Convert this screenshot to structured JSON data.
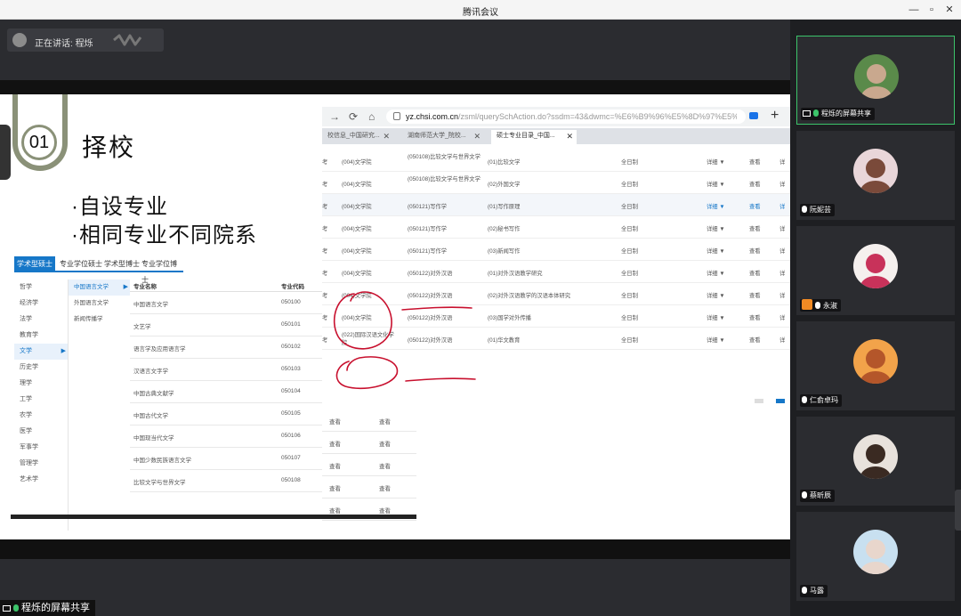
{
  "app": {
    "title": "腾讯会议"
  },
  "window_controls": [
    "—",
    "▫",
    "✕"
  ],
  "speaking": {
    "label": "正在讲话:",
    "name": "程烁"
  },
  "slide": {
    "number": "01",
    "title": "择校",
    "bullets": [
      "·自设专业",
      "·相同专业不同院系"
    ]
  },
  "degree_tabs": [
    "学术型硕士",
    "专业学位硕士",
    "学术型博士",
    "专业学位博士"
  ],
  "subjects": [
    "哲学",
    "经济学",
    "法学",
    "教育学",
    "文学",
    "历史学",
    "理学",
    "工学",
    "农学",
    "医学",
    "军事学",
    "管理学",
    "艺术学"
  ],
  "subjects_active": "文学",
  "subcategories": [
    "中国语言文学",
    "外国语言文学",
    "新闻传播学"
  ],
  "major_table": {
    "headers": [
      "专业名称",
      "专业代码"
    ],
    "rows": [
      [
        "中国语言文学",
        "050100"
      ],
      [
        "文艺学",
        "050101"
      ],
      [
        "语言学及应用语言学",
        "050102"
      ],
      [
        "汉语言文字学",
        "050103"
      ],
      [
        "中国古典文献学",
        "050104"
      ],
      [
        "中国古代文学",
        "050105"
      ],
      [
        "中国现当代文学",
        "050106"
      ],
      [
        "中国少数民族语言文学",
        "050107"
      ],
      [
        "比较文学与世界文学",
        "050108"
      ]
    ]
  },
  "extra_actions": [
    [
      "查看",
      "查看"
    ],
    [
      "查看",
      "查看"
    ],
    [
      "查看",
      "查看"
    ],
    [
      "查看",
      "查看"
    ],
    [
      "查看",
      "查看"
    ]
  ],
  "browser": {
    "url_host": "yz.chsi.com.cn",
    "url_path": "/zsml/querySchAction.do?ssdm=43&dwmc=%E6%B9%96%E5%8D%97%E5%B",
    "tabs": [
      "校信息_中国研究...",
      "湖南师范大学_院校...",
      "硕士专业目录_中国..."
    ],
    "rows": [
      [
        "考",
        "(004)文学院",
        "(050108)比较文学与世界文学",
        "(01)比较文学",
        "全日制",
        "详细 ▼",
        "查看",
        "详"
      ],
      [
        "考",
        "(004)文学院",
        "(050108)比较文学与世界文学",
        "(02)外国文学",
        "全日制",
        "详细 ▼",
        "查看",
        "详"
      ],
      [
        "考",
        "(004)文学院",
        "(050121)写作学",
        "(01)写作原理",
        "全日制",
        "详细 ▼",
        "查看",
        "详"
      ],
      [
        "考",
        "(004)文学院",
        "(050121)写作学",
        "(02)秘书写作",
        "全日制",
        "详细 ▼",
        "查看",
        "详"
      ],
      [
        "考",
        "(004)文学院",
        "(050121)写作学",
        "(03)新闻写作",
        "全日制",
        "详细 ▼",
        "查看",
        "详"
      ],
      [
        "考",
        "(004)文学院",
        "(050122)对外汉语",
        "(01)对外汉语教学研究",
        "全日制",
        "详细 ▼",
        "查看",
        "详"
      ],
      [
        "考",
        "(004)文学院",
        "(050122)对外汉语",
        "(02)对外汉语教学的汉语本体研究",
        "全日制",
        "详细 ▼",
        "查看",
        "详"
      ],
      [
        "考",
        "(004)文学院",
        "(050122)对外汉语",
        "(03)国学对外传播",
        "全日制",
        "详细 ▼",
        "查看",
        "详"
      ],
      [
        "考",
        "(022)国际汉语文化学院",
        "(050122)对外汉语",
        "(01)华文教育",
        "全日制",
        "详细 ▼",
        "查看",
        "详"
      ]
    ]
  },
  "participants": [
    {
      "name": "程烁的屏幕共享",
      "bg": "#5a8a4a",
      "fg": "#c9a88e"
    },
    {
      "name": "阮妮芸",
      "bg": "#e9d6d9",
      "fg": "#7a4a3a"
    },
    {
      "name": "永淑",
      "bg": "#f5f0ee",
      "fg": "#c8325a"
    },
    {
      "name": "仁俞卓玛",
      "bg": "#f2a34a",
      "fg": "#b4562a"
    },
    {
      "name": "蔡昕辰",
      "bg": "#e8e2dc",
      "fg": "#3a2a22"
    },
    {
      "name": "马露",
      "bg": "#c8e0f0",
      "fg": "#e8d6cc"
    }
  ],
  "bottom_label": "程烁的屏幕共享",
  "colors": {
    "accent": "#1677c8",
    "speaking": "#3cc46a",
    "annotation": "#c8102e",
    "slide_green": "#8a9178"
  }
}
